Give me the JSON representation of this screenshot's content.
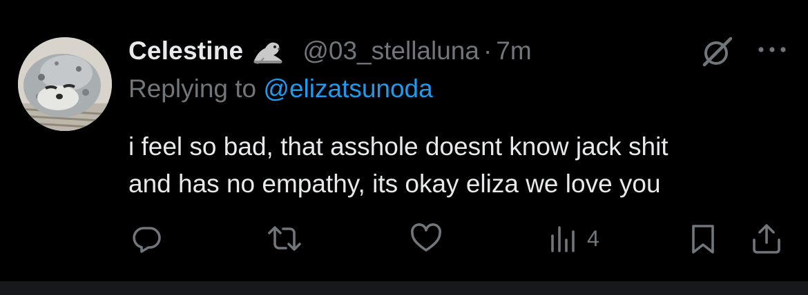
{
  "tweet": {
    "display_name": "Celestine",
    "name_emoji": "seal-emoji",
    "handle": "@03_stellaluna",
    "separator": "·",
    "time": "7m",
    "replying_prefix": "Replying to ",
    "replying_to": "@elizatsunoda",
    "text_line1": "i feel so bad, that asshole doesnt know jack shit",
    "text_line2": "and has no empathy, its okay eliza we love you"
  },
  "actions": {
    "reply_icon": "reply-icon",
    "retweet_icon": "retweet-icon",
    "like_icon": "heart-icon",
    "views_icon": "analytics-icon",
    "views_count": "4",
    "bookmark_icon": "bookmark-icon",
    "share_icon": "share-icon"
  },
  "colors": {
    "background": "#000000",
    "primary_text": "#e7e9ea",
    "secondary_text": "#71767b",
    "link": "#1d9bf0"
  }
}
